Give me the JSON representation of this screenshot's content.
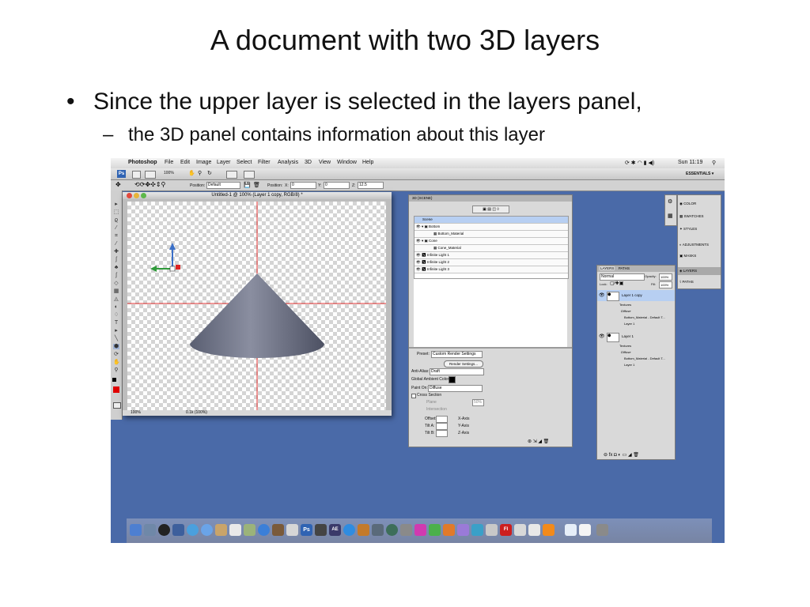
{
  "slide": {
    "title": "A document with two 3D layers",
    "bullet": "Since the upper layer is selected in the layers panel,",
    "subbullet": "the 3D panel contains information about this layer"
  },
  "menubar": {
    "app": "Photoshop",
    "items": [
      "File",
      "Edit",
      "Image",
      "Layer",
      "Select",
      "Filter",
      "Analysis",
      "3D",
      "View",
      "Window",
      "Help"
    ],
    "clock": "Sun 11:19"
  },
  "appbar": {
    "zoom": "100%",
    "workspace": "ESSENTIALS ▾"
  },
  "optbar": {
    "position_label": "Position:",
    "position_value": "Default",
    "pos_label": "Position:",
    "x_label": "X:",
    "x_value": "0",
    "y_label": "Y:",
    "y_value": "0",
    "z_label": "Z:",
    "z_value": "12.5"
  },
  "document": {
    "title": "Untitled-1 @ 100% (Layer 1 copy, RGB/8) *",
    "zoom": "100%",
    "info": "0.1k (100%)"
  },
  "panel3d": {
    "tab": "3D {SCENE}",
    "rows": [
      {
        "label": "Scene",
        "indent": 0
      },
      {
        "label": "Bottom",
        "indent": 1
      },
      {
        "label": "Bottom_Material",
        "indent": 2
      },
      {
        "label": "Cone",
        "indent": 1
      },
      {
        "label": "Cone_Material",
        "indent": 2
      },
      {
        "label": "Infinite Light 1",
        "indent": 1
      },
      {
        "label": "Infinite Light 2",
        "indent": 1
      },
      {
        "label": "Infinite Light 3",
        "indent": 1
      }
    ],
    "preset_label": "Preset:",
    "preset_value": "Custom Render Settings",
    "render_button": "Render Settings...",
    "antialias_label": "Anti-Alias:",
    "antialias_value": "Draft",
    "ambient_label": "Global Ambient Color:",
    "paint_label": "Paint On:",
    "paint_value": "Diffuse",
    "cross_section": "Cross Section",
    "plane": "Plane",
    "plane_value": "50%",
    "intersection": "Intersection",
    "offset_label": "Offset:",
    "tilt_a_label": "Tilt A:",
    "tilt_b_label": "Tilt B:",
    "x_axis": "X-Axis",
    "y_axis": "Y-Axis",
    "z_axis": "Z-Axis"
  },
  "layers": {
    "tabs": [
      "LAYERS",
      "PATHS"
    ],
    "blend_mode": "Normal",
    "opacity_label": "Opacity:",
    "opacity_value": "100%",
    "lock_label": "Lock:",
    "fill_label": "Fill:",
    "fill_value": "100%",
    "items": [
      {
        "name": "Layer 1 copy",
        "selected": true,
        "textures": "Textures",
        "diffuse": "Diffuse",
        "mat": "Bottom_Material - Default T...",
        "sub": "Layer 1"
      },
      {
        "name": "Layer 1",
        "selected": false,
        "textures": "Textures",
        "diffuse": "Diffuse",
        "mat": "Bottom_Material - Default T...",
        "sub": "Layer 1"
      }
    ]
  },
  "rightpanel": {
    "items": [
      "COLOR",
      "SWATCHES",
      "STYLES",
      "ADJUSTMENTS",
      "MASKS",
      "LAYERS",
      "PATHS"
    ]
  },
  "colors": {
    "desktop": "#4a6aa8",
    "selection": "#b7cff2",
    "foreground": "#e00000"
  }
}
